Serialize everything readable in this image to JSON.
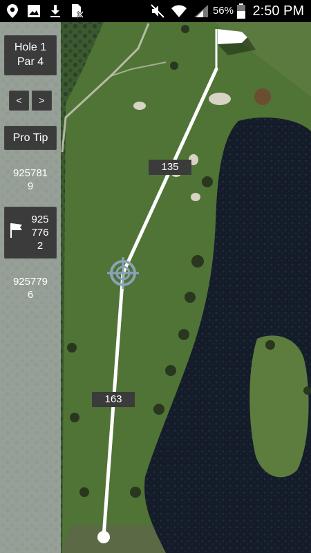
{
  "status_bar": {
    "battery": "56%",
    "time": "2:50 PM",
    "icons": [
      "location-icon",
      "image-icon",
      "download-icon",
      "sim-off-icon",
      "mute-icon",
      "wifi-icon",
      "signal-icon",
      "battery-icon"
    ]
  },
  "sidebar": {
    "hole_line1": "Hole 1",
    "hole_line2": "Par 4",
    "prev_label": "<",
    "next_label": ">",
    "pro_tip_label": "Pro Tip",
    "distance_1": [
      "925781",
      "9"
    ],
    "distance_2": [
      "925",
      "776",
      "2"
    ],
    "distance_3": [
      "925779",
      "6"
    ]
  },
  "map": {
    "upper_segment_label": "135",
    "lower_segment_label": "163",
    "colors": {
      "line": "#ffffff",
      "label_bg": "#3b3b3b",
      "water": "#141c2a",
      "fairway": "#4f7436"
    }
  }
}
